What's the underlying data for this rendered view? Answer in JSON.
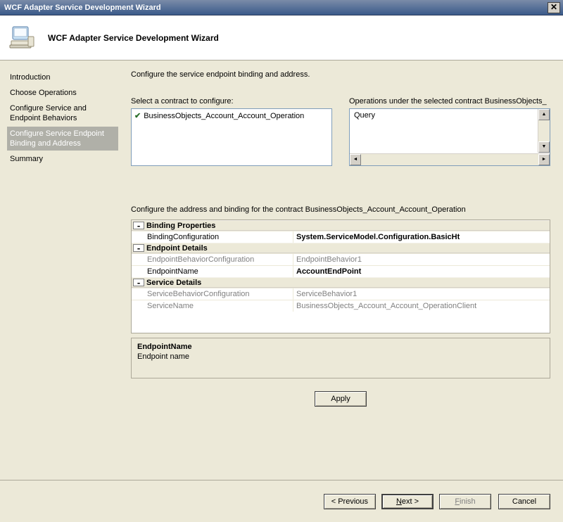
{
  "window": {
    "title": "WCF Adapter Service Development Wizard"
  },
  "header": {
    "title": "WCF Adapter Service Development Wizard"
  },
  "sidebar": {
    "items": [
      {
        "label": "Introduction"
      },
      {
        "label": "Choose Operations"
      },
      {
        "label": "Configure Service and Endpoint Behaviors"
      },
      {
        "label": "Configure Service Endpoint Binding and Address"
      },
      {
        "label": "Summary"
      }
    ],
    "selectedIndex": 3
  },
  "content": {
    "instruction": "Configure the service endpoint binding and address.",
    "contract_label": "Select a contract to configure:",
    "operations_label": "Operations under the selected contract  BusinessObjects_",
    "contract_item": "BusinessObjects_Account_Account_Operation",
    "operation_item": "Query",
    "config_label": "Configure the address and binding for the contract  BusinessObjects_Account_Account_Operation",
    "grid": {
      "groups": [
        {
          "title": "Binding Properties",
          "rows": [
            {
              "name": "BindingConfiguration",
              "value": "System.ServiceModel.Configuration.BasicHt",
              "bold": true,
              "readonly": false
            }
          ]
        },
        {
          "title": "Endpoint Details",
          "rows": [
            {
              "name": "EndpointBehaviorConfiguration",
              "value": "EndpointBehavior1",
              "readonly": true
            },
            {
              "name": "EndpointName",
              "value": "AccountEndPoint",
              "readonly": false,
              "bold": true,
              "selected": true
            }
          ]
        },
        {
          "title": "Service Details",
          "rows": [
            {
              "name": "ServiceBehaviorConfiguration",
              "value": "ServiceBehavior1",
              "readonly": true
            },
            {
              "name": "ServiceName",
              "value": "BusinessObjects_Account_Account_OperationClient",
              "readonly": true
            }
          ]
        }
      ]
    },
    "description": {
      "title": "EndpointName",
      "text": "Endpoint name"
    },
    "apply_label": "Apply"
  },
  "footer": {
    "previous": "< Previous",
    "next": "Next >",
    "finish": "Finish",
    "cancel": "Cancel"
  }
}
